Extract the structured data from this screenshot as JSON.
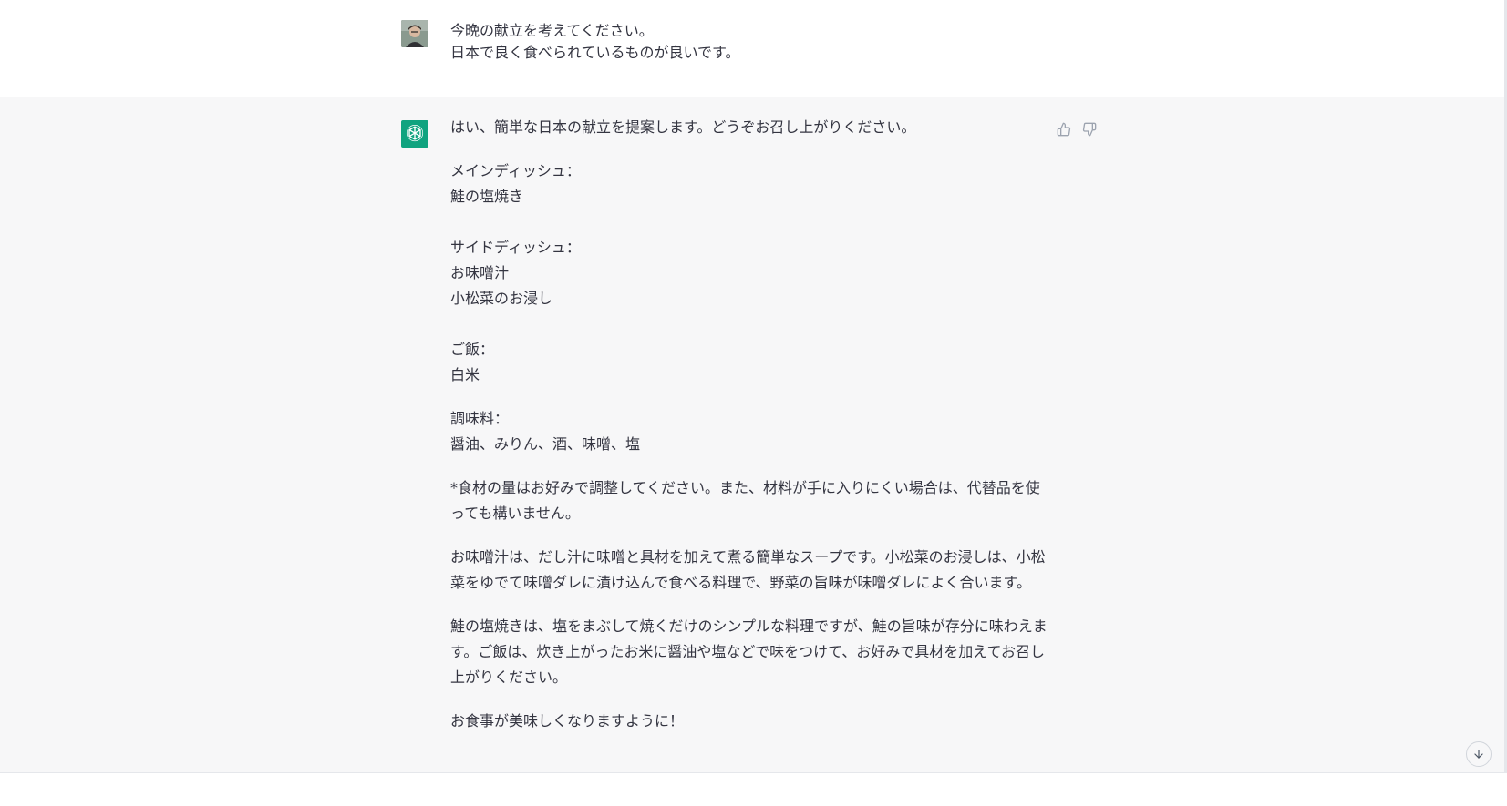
{
  "user_message": {
    "lines": [
      "今晩の献立を考えてください。",
      "日本で良く食べられているものが良いです。"
    ]
  },
  "assistant_message": {
    "intro": "はい、簡単な日本の献立を提案します。どうぞお召し上がりください。",
    "main_dish_heading": "メインディッシュ：",
    "main_dish": "鮭の塩焼き",
    "side_dish_heading": "サイドディッシュ：",
    "side_dish_1": "お味噌汁",
    "side_dish_2": "小松菜のお浸し",
    "rice_heading": "ご飯：",
    "rice": "白米",
    "seasoning_heading": "調味料：",
    "seasoning": "醤油、みりん、酒、味噌、塩",
    "note": "*食材の量はお好みで調整してください。また、材料が手に入りにくい場合は、代替品を使っても構いません。",
    "paragraph_1": "お味噌汁は、だし汁に味噌と具材を加えて煮る簡単なスープです。小松菜のお浸しは、小松菜をゆでて味噌ダレに漬け込んで食べる料理で、野菜の旨味が味噌ダレによく合います。",
    "paragraph_2": "鮭の塩焼きは、塩をまぶして焼くだけのシンプルな料理ですが、鮭の旨味が存分に味わえます。ご飯は、炊き上がったお米に醤油や塩などで味をつけて、お好みで具材を加えてお召し上がりください。",
    "closing": "お食事が美味しくなりますように！"
  },
  "icons": {
    "user_avatar": "user-avatar",
    "bot_avatar": "openai-logo-icon",
    "thumbs_up": "thumbs-up-icon",
    "thumbs_down": "thumbs-down-icon",
    "scroll_down": "arrow-down-icon"
  },
  "colors": {
    "bot_avatar_bg": "#10a37f",
    "assistant_bg": "#f7f7f8",
    "text": "#343541"
  }
}
